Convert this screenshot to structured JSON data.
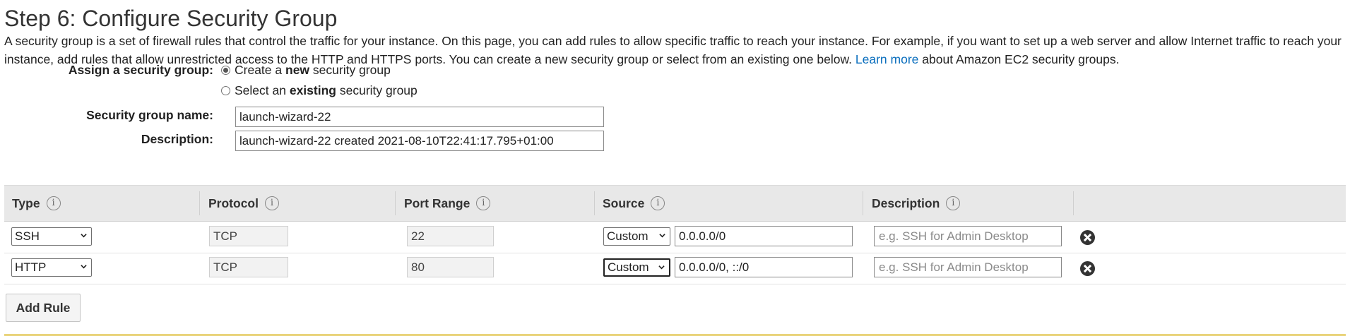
{
  "page": {
    "title": "Step 6: Configure Security Group",
    "intro_text": "A security group is a set of firewall rules that control the traffic for your instance. On this page, you can add rules to allow specific traffic to reach your instance. For example, if you want to set up a web server and allow Internet traffic to reach your instance, add rules that allow unrestricted access to the HTTP and HTTPS ports. You can create a new security group or select from an existing one below.",
    "learn_more_link": "Learn more",
    "intro_suffix": "about Amazon EC2 security groups."
  },
  "assign": {
    "label": "Assign a security group:",
    "option_new_pre": "Create a",
    "option_new_bold": "new",
    "option_new_post": "security group",
    "option_existing_pre": "Select an",
    "option_existing_bold": "existing",
    "option_existing_post": "security group",
    "selected": "new"
  },
  "group_name": {
    "label": "Security group name:",
    "value": "launch-wizard-22"
  },
  "description": {
    "label": "Description:",
    "value": "launch-wizard-22 created 2021-08-10T22:41:17.795+01:00"
  },
  "rules_table": {
    "headers": {
      "type": "Type",
      "protocol": "Protocol",
      "port_range": "Port Range",
      "source": "Source",
      "description": "Description"
    },
    "info_glyph": "i",
    "rows": [
      {
        "type": "SSH",
        "protocol": "TCP",
        "port_range": "22",
        "source_mode": "Custom",
        "source_value": "0.0.0.0/0",
        "description_placeholder": "e.g. SSH for Admin Desktop"
      },
      {
        "type": "HTTP",
        "protocol": "TCP",
        "port_range": "80",
        "source_mode": "Custom",
        "source_value": "0.0.0.0/0, ::/0",
        "description_placeholder": "e.g. SSH for Admin Desktop"
      }
    ]
  },
  "add_rule_button": "Add Rule",
  "colors": {
    "link": "#0a6ebd",
    "header_bg": "#e8e8e8",
    "warning_strip": "#e9d37a"
  },
  "icons": {
    "info": "info-icon",
    "remove": "close-circle-icon",
    "dropdown": "chevron-down-icon"
  }
}
